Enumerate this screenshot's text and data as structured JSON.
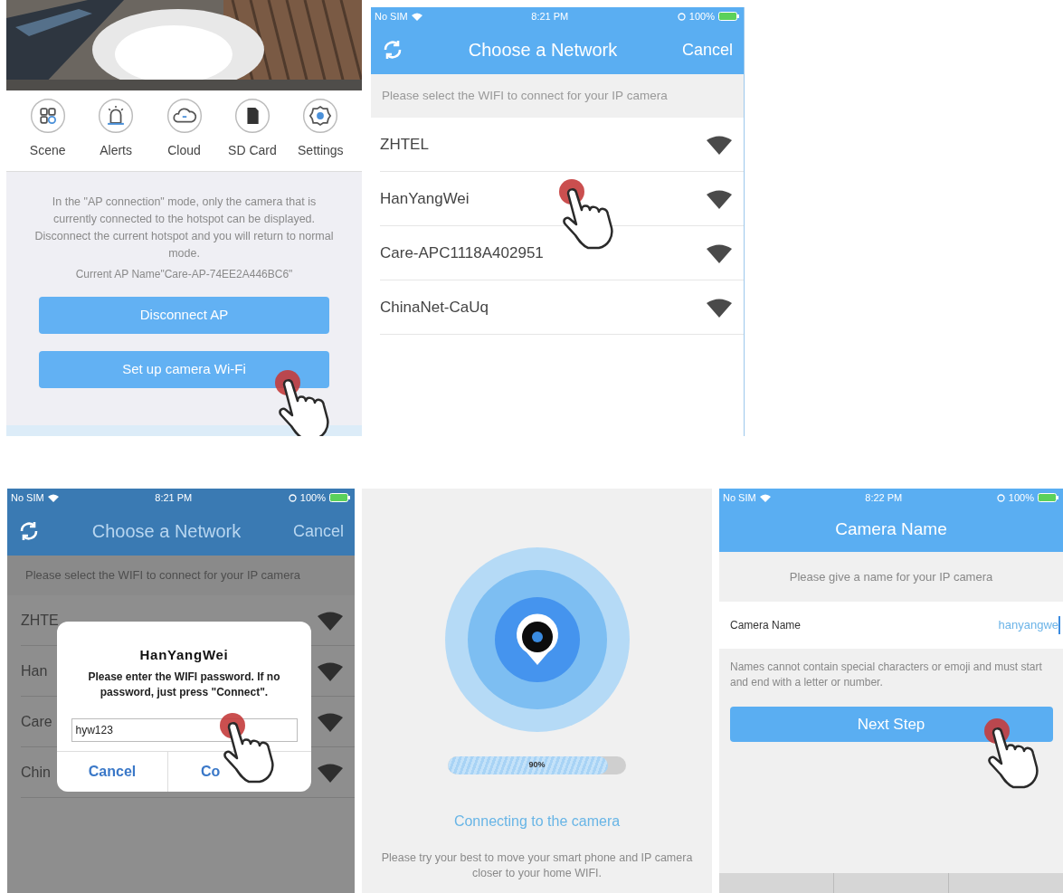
{
  "camera_home": {
    "menu": [
      {
        "label": "Scene"
      },
      {
        "label": "Alerts"
      },
      {
        "label": "Cloud"
      },
      {
        "label": "SD Card"
      },
      {
        "label": "Settings"
      }
    ],
    "notice": "In the \"AP connection\" mode, only the camera that is currently connected to the hotspot can be displayed. Disconnect the current hotspot and you will return to normal mode.",
    "ap_name": "Current AP Name\"Care-AP-74EE2A446BC6\"",
    "buttons": [
      "Disconnect AP",
      "Set up camera Wi-Fi"
    ]
  },
  "network_list": {
    "status_bar": {
      "carrier": "No SIM",
      "time": "8:21 PM",
      "battery": "100%"
    },
    "title": "Choose a Network",
    "cancel": "Cancel",
    "prompt": "Please select the WIFI to connect for your IP camera",
    "networks": [
      {
        "name": "ZHTEL"
      },
      {
        "name": "HanYangWei"
      },
      {
        "name": "Care-APC1118A402951"
      },
      {
        "name": "ChinaNet-CaUq"
      }
    ]
  },
  "password_screen": {
    "status_bar": {
      "carrier": "No SIM",
      "time": "8:21 PM",
      "battery": "100%"
    },
    "title": "Choose a Network",
    "cancel": "Cancel",
    "prompt": "Please select the WIFI to connect for your IP camera",
    "networks": [
      {
        "name": "ZHTE"
      },
      {
        "name": "Han"
      },
      {
        "name": "Care"
      },
      {
        "name": "Chin"
      }
    ],
    "dialog": {
      "title": "HanYangWei",
      "message": "Please enter the WIFI password. If no password, just press \"Connect\".",
      "value": "hyw123",
      "buttons": [
        "Cancel",
        "Co"
      ]
    }
  },
  "connecting": {
    "progress": {
      "level": 0.9,
      "label": "90%"
    },
    "title": "Connecting to the camera",
    "hint": "Please try your best to move your smart phone and IP camera closer to your home WIFI."
  },
  "camera_name": {
    "status_bar": {
      "carrier": "No SIM",
      "time": "8:22 PM",
      "battery": "100%"
    },
    "title": "Camera Name",
    "prompt": "Please give a name for your IP camera",
    "field": {
      "label": "Camera Name",
      "value": "hanyangwe"
    },
    "note": "Names cannot contain special characters or emoji and must start and end with a letter or number.",
    "button": "Next Step"
  }
}
